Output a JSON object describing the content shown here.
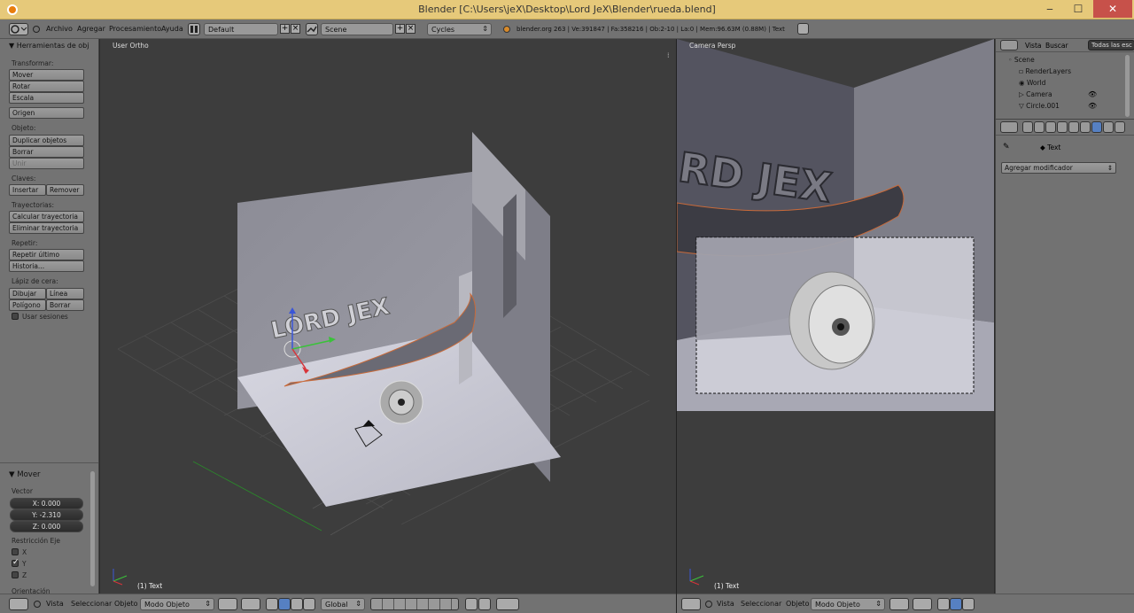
{
  "window": {
    "title": "Blender [C:\\Users\\jeX\\Desktop\\Lord JeX\\Blender\\rueda.blend]",
    "minimize": "‒",
    "maximize": "☐",
    "close": "✕"
  },
  "menus": [
    "Archivo",
    "Agregar",
    "Procesamiento",
    "Ayuda"
  ],
  "screen_layout": "Default",
  "scene": "Scene",
  "render_engine": "Cycles",
  "status": "blender.org 263 | Ve:391847 | Fa:358216 | Ob:2-10 | La:0 | Mem:96.63M (0.88M) | Text",
  "toolshelf": {
    "header": "Herramientas de obj",
    "transform_label": "Transformar:",
    "move": "Mover",
    "rotate": "Rotar",
    "scale": "Escala",
    "origin": "Origen",
    "object_label": "Objeto:",
    "duplicate": "Duplicar objetos",
    "delete": "Borrar",
    "join": "Unir",
    "keys_label": "Claves:",
    "insert": "Insertar",
    "remove": "Remover",
    "paths_label": "Trayectorias:",
    "calc_path": "Calcular trayectoria",
    "clear_path": "Eliminar trayectoria",
    "repeat_label": "Repetir:",
    "repeat_last": "Repetir último",
    "history": "Historia...",
    "grease_label": "Lápiz de cera:",
    "draw": "Dibujar",
    "line": "Línea",
    "poly": "Polígono",
    "erase": "Borrar",
    "use_sketching": "Usar sesiones"
  },
  "operator": {
    "header": "Mover",
    "vector_label": "Vector",
    "x": "X: 0.000",
    "y": "Y: -2.310",
    "z": "Z: 0.000",
    "constraint_label": "Restricción Eje",
    "ax": "X",
    "ay": "Y",
    "az": "Z",
    "orientation_label": "Orientación",
    "constraint_x": false,
    "constraint_y": true,
    "constraint_z": false
  },
  "viewport_left": {
    "title": "User Ortho",
    "footer": "(1) Text",
    "logo_text": "LORD JEX"
  },
  "viewport_right": {
    "title": "Camera Persp",
    "footer": "(1) Text",
    "logo_text": "RD JEX"
  },
  "bottom_left": {
    "view": "Vista",
    "select": "Seleccionar",
    "object": "Objeto",
    "mode": "Modo Objeto",
    "orientation": "Global"
  },
  "bottom_right": {
    "view": "Vista",
    "select": "Seleccionar",
    "object": "Objeto",
    "mode": "Modo Objeto"
  },
  "outliner": {
    "view": "Vista",
    "search": "Buscar",
    "filter": "Todas las esc",
    "items": [
      "Scene",
      "RenderLayers",
      "World",
      "Camera",
      "Circle.001"
    ]
  },
  "properties": {
    "context_object": "Text",
    "add_modifier": "Agregar modificador"
  },
  "colors": {
    "accent_blue": "#5680c2",
    "title_bar": "#e6c97a",
    "header_gray": "#727272",
    "viewport_bg": "#3d3d3d"
  }
}
